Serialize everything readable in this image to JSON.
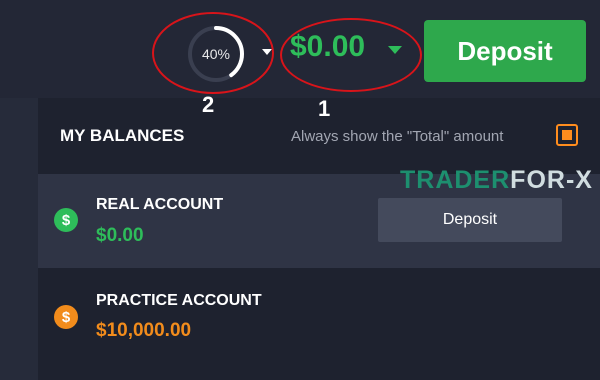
{
  "header": {
    "progress_percent": 40,
    "progress_text": "40%",
    "balance": "$0.00",
    "deposit_label": "Deposit",
    "annotation_1": "1",
    "annotation_2": "2"
  },
  "balances": {
    "title": "MY BALANCES",
    "always_show_label": "Always show the \"Total\" amount",
    "always_show_checked": true,
    "accounts": [
      {
        "label": "REAL ACCOUNT",
        "amount": "$0.00",
        "icon": "dollar-coin-icon",
        "color": "#2ebd5a",
        "deposit_label": "Deposit"
      },
      {
        "label": "PRACTICE ACCOUNT",
        "amount": "$10,000.00",
        "icon": "dollar-coin-icon",
        "color": "#f28c1c"
      }
    ]
  },
  "watermark": {
    "part1": "TRADER",
    "part2": "FOR",
    "part3": "-",
    "part4": "X"
  },
  "colors": {
    "accent_green": "#2ebd5a",
    "accent_orange": "#f28c1c",
    "annotation_red": "#d8141a"
  }
}
